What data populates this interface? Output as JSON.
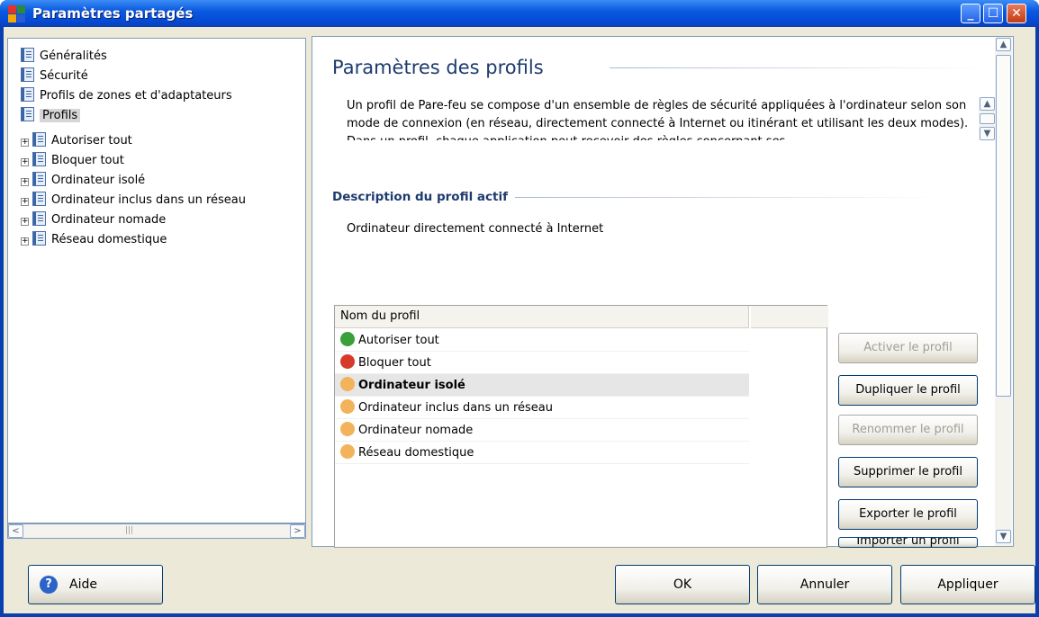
{
  "window": {
    "title": "Paramètres partagés"
  },
  "tree": {
    "items": [
      {
        "label": "Généralités"
      },
      {
        "label": "Sécurité"
      },
      {
        "label": "Profils de zones et d'adaptateurs"
      },
      {
        "label": "Profils"
      }
    ],
    "children": [
      {
        "label": "Autoriser tout"
      },
      {
        "label": "Bloquer tout"
      },
      {
        "label": "Ordinateur isolé"
      },
      {
        "label": "Ordinateur inclus dans un réseau"
      },
      {
        "label": "Ordinateur nomade"
      },
      {
        "label": "Réseau domestique"
      }
    ],
    "selected": "Profils"
  },
  "main": {
    "heading": "Paramètres des profils",
    "description": "Un profil de Pare-feu se compose d'un ensemble de règles de sécurité appliquées à l'ordinateur selon son mode de connexion (en réseau, directement connecté à Internet ou itinérant et utilisant les deux modes). Dans un profil, chaque application peut recevoir des règles concernant ses",
    "active_heading": "Description du profil actif",
    "active_description": "Ordinateur directement connecté à Internet",
    "grid": {
      "column": "Nom du profil",
      "rows": [
        {
          "label": "Autoriser tout",
          "icon": "allow-icon"
        },
        {
          "label": "Bloquer tout",
          "icon": "block-icon"
        },
        {
          "label": "Ordinateur isolé",
          "icon": "user-icon",
          "selected": true
        },
        {
          "label": "Ordinateur inclus dans un réseau",
          "icon": "user-icon"
        },
        {
          "label": "Ordinateur nomade",
          "icon": "user-icon"
        },
        {
          "label": "Réseau domestique",
          "icon": "user-icon"
        }
      ]
    },
    "buttons": {
      "activate": "Activer le profil",
      "duplicate": "Dupliquer le profil",
      "rename": "Renommer le profil",
      "delete": "Supprimer le profil",
      "export": "Exporter le profil",
      "import": "Importer un profil"
    }
  },
  "footer": {
    "help": "Aide",
    "ok": "OK",
    "cancel": "Annuler",
    "apply": "Appliquer"
  },
  "colors": {
    "titlebar": "#0a5ae0",
    "heading": "#1d3b6e",
    "face": "#ece9d8"
  }
}
